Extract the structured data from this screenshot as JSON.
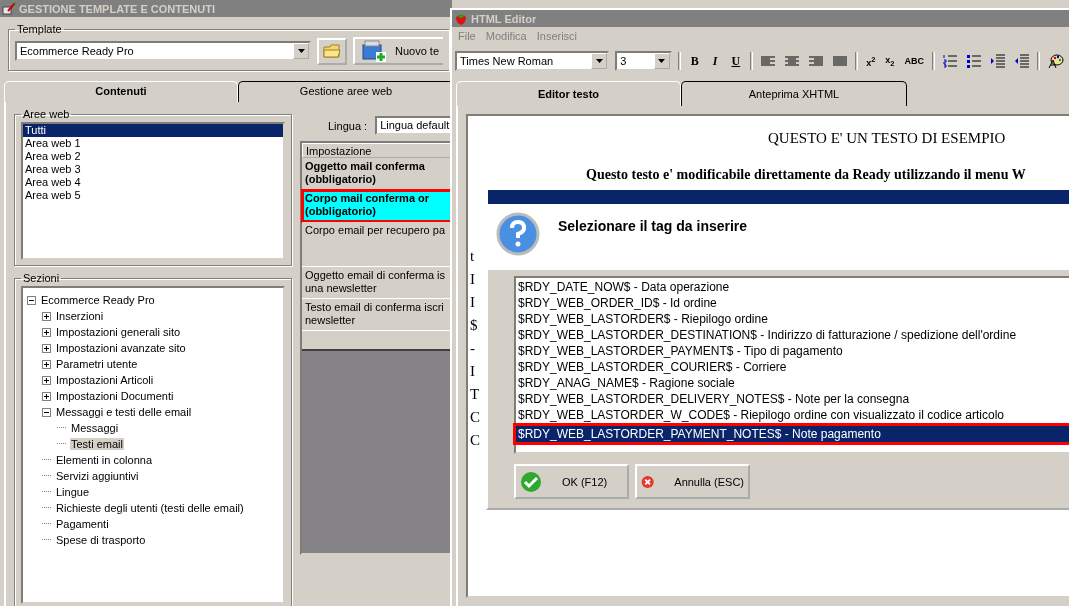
{
  "main_window": {
    "title": "GESTIONE TEMPLATE E CONTENUTI",
    "template_label": "Template",
    "template_value": "Ecommerce Ready Pro",
    "new_button": "Nuovo te",
    "tabs": [
      {
        "label": "Contenuti",
        "selected": true
      },
      {
        "label": "Gestione aree web",
        "selected": false
      }
    ],
    "web_areas": {
      "label": "Aree web",
      "items": [
        {
          "label": "Tutti",
          "selected": true
        },
        {
          "label": "Area web 1",
          "selected": false
        },
        {
          "label": "Area web 2",
          "selected": false
        },
        {
          "label": "Area web 3",
          "selected": false
        },
        {
          "label": "Area web 4",
          "selected": false
        },
        {
          "label": "Area web 5",
          "selected": false
        }
      ]
    },
    "sections": {
      "label": "Sezioni",
      "tree": [
        {
          "label": "Ecommerce Ready Pro",
          "kind": "group",
          "expanded": true,
          "selected": false,
          "children": [
            {
              "label": "Inserzioni",
              "kind": "group",
              "expanded": false,
              "selected": false
            },
            {
              "label": "Impostazioni generali sito",
              "kind": "group",
              "expanded": false,
              "selected": false
            },
            {
              "label": "Impostazioni avanzate sito",
              "kind": "group",
              "expanded": false,
              "selected": false
            },
            {
              "label": "Parametri utente",
              "kind": "group",
              "expanded": false,
              "selected": false
            },
            {
              "label": "Impostazioni Articoli",
              "kind": "group",
              "expanded": false,
              "selected": false
            },
            {
              "label": "Impostazioni Documenti",
              "kind": "group",
              "expanded": false,
              "selected": false
            },
            {
              "label": "Messaggi e testi delle email",
              "kind": "group",
              "expanded": true,
              "selected": false,
              "children": [
                {
                  "label": "Messaggi",
                  "kind": "leaf",
                  "selected": false
                },
                {
                  "label": "Testi email",
                  "kind": "leaf",
                  "selected": true
                }
              ]
            },
            {
              "label": "Elementi in colonna",
              "kind": "leaf",
              "selected": false
            },
            {
              "label": "Servizi aggiuntivi",
              "kind": "leaf",
              "selected": false
            },
            {
              "label": "Lingue",
              "kind": "leaf",
              "selected": false
            },
            {
              "label": "Richieste degli utenti (testi delle email)",
              "kind": "leaf",
              "selected": false
            },
            {
              "label": "Pagamenti",
              "kind": "leaf",
              "selected": false
            },
            {
              "label": "Spese di trasporto",
              "kind": "leaf",
              "selected": false
            }
          ]
        }
      ]
    },
    "language": {
      "label": "Lingua :",
      "value": "Lingua default"
    },
    "settings_table": {
      "column": "Impostazione",
      "rows": [
        {
          "text": "Oggetto mail conferma\n(obbligatorio)",
          "bold": true,
          "selected": false,
          "highlighted": false
        },
        {
          "text": "Corpo mail conferma or\n(obbligatorio)",
          "bold": true,
          "selected": true,
          "highlighted": true
        },
        {
          "text": "Corpo email per recupero pa",
          "bold": false,
          "selected": false,
          "highlighted": false
        },
        {
          "text": "Oggetto email di conferma is\nuna newsletter",
          "bold": false,
          "selected": false,
          "highlighted": false
        },
        {
          "text": "Testo email di conferma iscri\nnewsletter",
          "bold": false,
          "selected": false,
          "highlighted": false
        }
      ]
    }
  },
  "editor_window": {
    "title": "HTML Editor",
    "menu": [
      {
        "label": "File",
        "disabled": true
      },
      {
        "label": "Modifica",
        "disabled": true
      },
      {
        "label": "Inserisci",
        "disabled": true
      }
    ],
    "font": "Times New Roman",
    "size": "3",
    "format_buttons": [
      "B",
      "I",
      "U"
    ],
    "script_buttons": [
      "x$^{2}$",
      "x$_{2}$",
      "ABC"
    ],
    "tabs": [
      {
        "label": "Editor testo",
        "selected": true
      },
      {
        "label": "Anteprima XHTML",
        "selected": false
      }
    ],
    "heading": "QUESTO E' UN TESTO DI ESEMPIO",
    "paragraph": "Questo testo e' modificabile direttamente da Ready utilizzando il menu W",
    "line_starts": [
      "t",
      "I",
      "I",
      "$",
      "-",
      "I",
      "T",
      "C",
      "C"
    ]
  },
  "tag_dialog": {
    "title": "Selezionare il tag da inserire",
    "tags": [
      {
        "text": "$RDY_DATE_NOW$ - Data operazione",
        "selected": false,
        "highlighted": false
      },
      {
        "text": "$RDY_WEB_ORDER_ID$ - Id ordine",
        "selected": false,
        "highlighted": false
      },
      {
        "text": "$RDY_WEB_LASTORDER$ - Riepilogo ordine",
        "selected": false,
        "highlighted": false
      },
      {
        "text": "$RDY_WEB_LASTORDER_DESTINATION$ - Indirizzo di fatturazione / spedizione dell'ordine",
        "selected": false,
        "highlighted": false
      },
      {
        "text": "$RDY_WEB_LASTORDER_PAYMENT$ - Tipo di pagamento",
        "selected": false,
        "highlighted": false
      },
      {
        "text": "$RDY_WEB_LASTORDER_COURIER$ - Corriere",
        "selected": false,
        "highlighted": false
      },
      {
        "text": "$RDY_ANAG_NAME$ - Ragione sociale",
        "selected": false,
        "highlighted": false
      },
      {
        "text": "$RDY_WEB_LASTORDER_DELIVERY_NOTES$ - Note per la consegna",
        "selected": false,
        "highlighted": false
      },
      {
        "text": "$RDY_WEB_LASTORDER_W_CODE$ - Riepilogo ordine con visualizzato il codice articolo",
        "selected": false,
        "highlighted": false
      },
      {
        "text": "$RDY_WEB_LASTORDER_PAYMENT_NOTES$ - Note pagamento",
        "selected": true,
        "highlighted": true
      }
    ],
    "ok_button": "OK (F12)",
    "cancel_button": "Annulla (ESC)"
  }
}
